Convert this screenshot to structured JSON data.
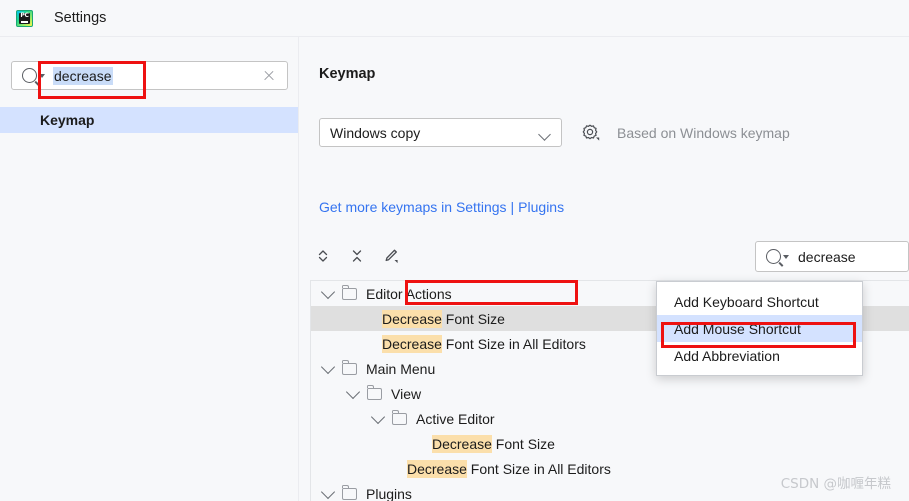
{
  "window": {
    "app_icon": "pycharm-icon",
    "title": "Settings"
  },
  "sidebar": {
    "search": {
      "icon": "search-icon",
      "value": "decrease",
      "placeholder": "",
      "clear_icon": "clear-icon"
    },
    "items": [
      {
        "label": "Keymap",
        "selected": true
      }
    ]
  },
  "main": {
    "title": "Keymap",
    "keymap_select": {
      "value": "Windows copy",
      "chevron": "chevron-down-icon"
    },
    "gear_icon": "gear-icon",
    "based_on": "Based on Windows keymap",
    "links": {
      "primary": "Get more keymaps in Settings",
      "separator": "|",
      "secondary": "Plugins"
    },
    "toolbar": {
      "expand_all_icon": "expand-all-icon",
      "collapse_all_icon": "collapse-all-icon",
      "edit_icon": "edit-pencil-icon"
    },
    "tree_search": {
      "icon": "search-icon",
      "value": "decrease"
    },
    "tree": [
      {
        "depth": 0,
        "type": "folder",
        "expanded": true,
        "label": "Editor Actions",
        "highlight": "",
        "rest": "Editor Actions",
        "selected": false
      },
      {
        "depth": 2,
        "type": "action",
        "expanded": false,
        "label": "Decrease Font Size",
        "highlight": "Decrease",
        "rest": " Font Size",
        "selected": true
      },
      {
        "depth": 2,
        "type": "action",
        "expanded": false,
        "label": "Decrease Font Size in All Editors",
        "highlight": "Decrease",
        "rest": " Font Size in All Editors",
        "selected": false
      },
      {
        "depth": 0,
        "type": "folder",
        "expanded": true,
        "label": "Main Menu",
        "highlight": "",
        "rest": "Main Menu",
        "selected": false
      },
      {
        "depth": 1,
        "type": "folder",
        "expanded": true,
        "label": "View",
        "highlight": "",
        "rest": "View",
        "selected": false
      },
      {
        "depth": 2,
        "type": "folder",
        "expanded": true,
        "label": "Active Editor",
        "highlight": "",
        "rest": "Active Editor",
        "selected": false
      },
      {
        "depth": 4,
        "type": "action",
        "expanded": false,
        "label": "Decrease Font Size",
        "highlight": "Decrease",
        "rest": " Font Size",
        "selected": false
      },
      {
        "depth": 3,
        "type": "action",
        "expanded": false,
        "label": "Decrease Font Size in All Editors",
        "highlight": "Decrease",
        "rest": " Font Size in All Editors",
        "selected": false
      },
      {
        "depth": 0,
        "type": "folder",
        "expanded": true,
        "label": "Plugins",
        "highlight": "",
        "rest": "Plugins",
        "selected": false
      }
    ]
  },
  "context_menu": {
    "items": [
      {
        "label": "Add Keyboard Shortcut",
        "active": false
      },
      {
        "label": "Add Mouse Shortcut",
        "active": true
      },
      {
        "label": "Add Abbreviation",
        "active": false
      }
    ]
  },
  "annotations": {
    "color": "#ee1111",
    "targets": [
      "sidebar-search-field",
      "tree-row-decrease-font-size",
      "context-menu-add-mouse-shortcut"
    ]
  },
  "watermark": "CSDN @咖喱年糕",
  "colors": {
    "window_bg": "#f7f8fa",
    "selection_blue": "#d4e2ff",
    "tree_selection_gray": "#dfdfdf",
    "match_highlight": "#fbdfab",
    "link_blue": "#3574f0",
    "text_selection": "#c9dcf8",
    "annotation_red": "#ee1111"
  }
}
